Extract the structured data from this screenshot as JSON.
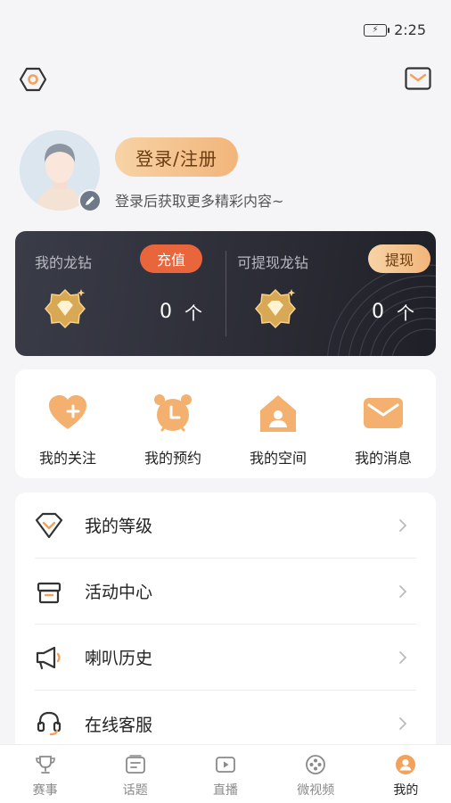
{
  "status": {
    "time": "2:25"
  },
  "colors": {
    "accent": "#e9653b",
    "gold_start": "#f7d3a6",
    "gold_end": "#f1b57a",
    "wallet_bg": "#2b2c35",
    "icon_orange": "#f2a25c"
  },
  "header": {
    "settings_icon": "hexagon-settings-icon",
    "mail_icon": "mail-icon"
  },
  "profile": {
    "login_label": "登录/注册",
    "tip": "登录后获取更多精彩内容~"
  },
  "wallet": {
    "left": {
      "label": "我的龙钻",
      "button": "充值",
      "value": "0",
      "unit": "个"
    },
    "right": {
      "label": "可提现龙钻",
      "button": "提现",
      "value": "0",
      "unit": "个"
    }
  },
  "quick_actions": [
    {
      "label": "我的关注",
      "icon": "heart-plus-icon"
    },
    {
      "label": "我的预约",
      "icon": "alarm-clock-icon"
    },
    {
      "label": "我的空间",
      "icon": "house-user-icon"
    },
    {
      "label": "我的消息",
      "icon": "envelope-icon"
    }
  ],
  "menu": [
    {
      "label": "我的等级",
      "icon": "diamond-level-icon"
    },
    {
      "label": "活动中心",
      "icon": "gift-icon"
    },
    {
      "label": "喇叭历史",
      "icon": "megaphone-icon"
    },
    {
      "label": "在线客服",
      "icon": "headset-icon"
    }
  ],
  "tabbar": [
    {
      "label": "赛事",
      "icon": "trophy-icon",
      "active": false
    },
    {
      "label": "话题",
      "icon": "topic-card-icon",
      "active": false
    },
    {
      "label": "直播",
      "icon": "play-screen-icon",
      "active": false
    },
    {
      "label": "微视频",
      "icon": "film-reel-icon",
      "active": false
    },
    {
      "label": "我的",
      "icon": "user-profile-icon",
      "active": true
    }
  ]
}
